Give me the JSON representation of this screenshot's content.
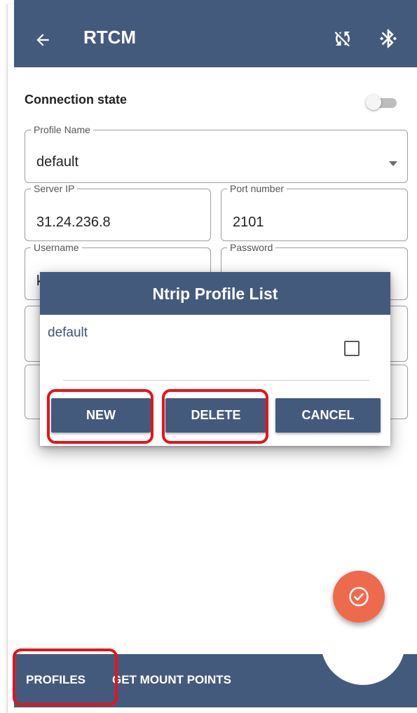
{
  "app": {
    "title": "RTCM",
    "icons": {
      "back": "arrow-back-icon",
      "sync": "sync-disabled-icon",
      "bluetooth": "bluetooth-icon"
    }
  },
  "connection": {
    "label": "Connection state",
    "enabled": false
  },
  "form": {
    "profile_name": {
      "label": "Profile Name",
      "value": "default"
    },
    "server_ip": {
      "label": "Server IP",
      "value": "31.24.236.8"
    },
    "port_number": {
      "label": "Port number",
      "value": "2101"
    },
    "username": {
      "label": "Username",
      "value": "karami"
    },
    "password": {
      "label": "Password",
      "value": "•••••"
    }
  },
  "dialog": {
    "title": "Ntrip Profile List",
    "items": [
      {
        "label": "default",
        "checked": false
      }
    ],
    "buttons": {
      "new": "NEW",
      "delete": "DELETE",
      "cancel": "CANCEL"
    }
  },
  "bottom_bar": {
    "profiles": "PROFILES",
    "get_mount_points": "GET MOUNT POINTS"
  },
  "fab": {
    "icon": "check-circle-icon"
  },
  "colors": {
    "primary": "#445a7d",
    "accent": "#ee6a4d",
    "highlight": "#e5141b"
  }
}
